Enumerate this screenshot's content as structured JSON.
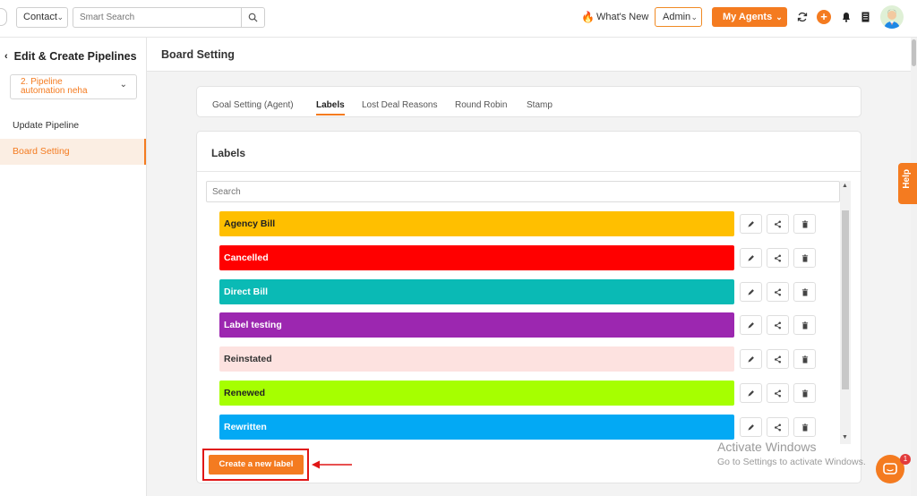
{
  "topbar": {
    "contact_select": "Contact",
    "search_placeholder": "Smart Search",
    "whats_new": "What's New",
    "admin_select": "Admin",
    "my_agents": "My Agents"
  },
  "sidebar": {
    "back_title": "Edit & Create Pipelines",
    "pipeline_select_line1": "2. Pipeline",
    "pipeline_select_line2": "automation neha",
    "items": [
      {
        "label": "Update Pipeline"
      },
      {
        "label": "Board Setting"
      }
    ]
  },
  "main": {
    "title": "Board Setting",
    "tabs": [
      {
        "label": "Goal Setting (Agent)"
      },
      {
        "label": "Labels"
      },
      {
        "label": "Lost Deal Reasons"
      },
      {
        "label": "Round Robin"
      },
      {
        "label": "Stamp"
      }
    ],
    "labels_card": {
      "title": "Labels",
      "search_placeholder": "Search",
      "create_button": "Create a new label"
    }
  },
  "labels": [
    {
      "name": "Agency Bill",
      "color": "#ffbf00",
      "text_color": "#222222"
    },
    {
      "name": "Cancelled",
      "color": "#ff0000",
      "text_color": "#ffffff"
    },
    {
      "name": "Direct Bill",
      "color": "#0abab5",
      "text_color": "#ffffff"
    },
    {
      "name": "Label testing",
      "color": "#9c27b0",
      "text_color": "#ffffff"
    },
    {
      "name": "Reinstated",
      "color": "#fde2e0",
      "text_color": "#333333"
    },
    {
      "name": "Renewed",
      "color": "#a6ff00",
      "text_color": "#222222"
    },
    {
      "name": "Rewritten",
      "color": "#03a9f4",
      "text_color": "#ffffff"
    }
  ],
  "help_tab": "Help",
  "watermark": {
    "line1": "Activate Windows",
    "line2": "Go to Settings to activate Windows."
  },
  "chat_badge": "1",
  "colors": {
    "accent": "#f47b20",
    "highlight": "#e01616"
  }
}
